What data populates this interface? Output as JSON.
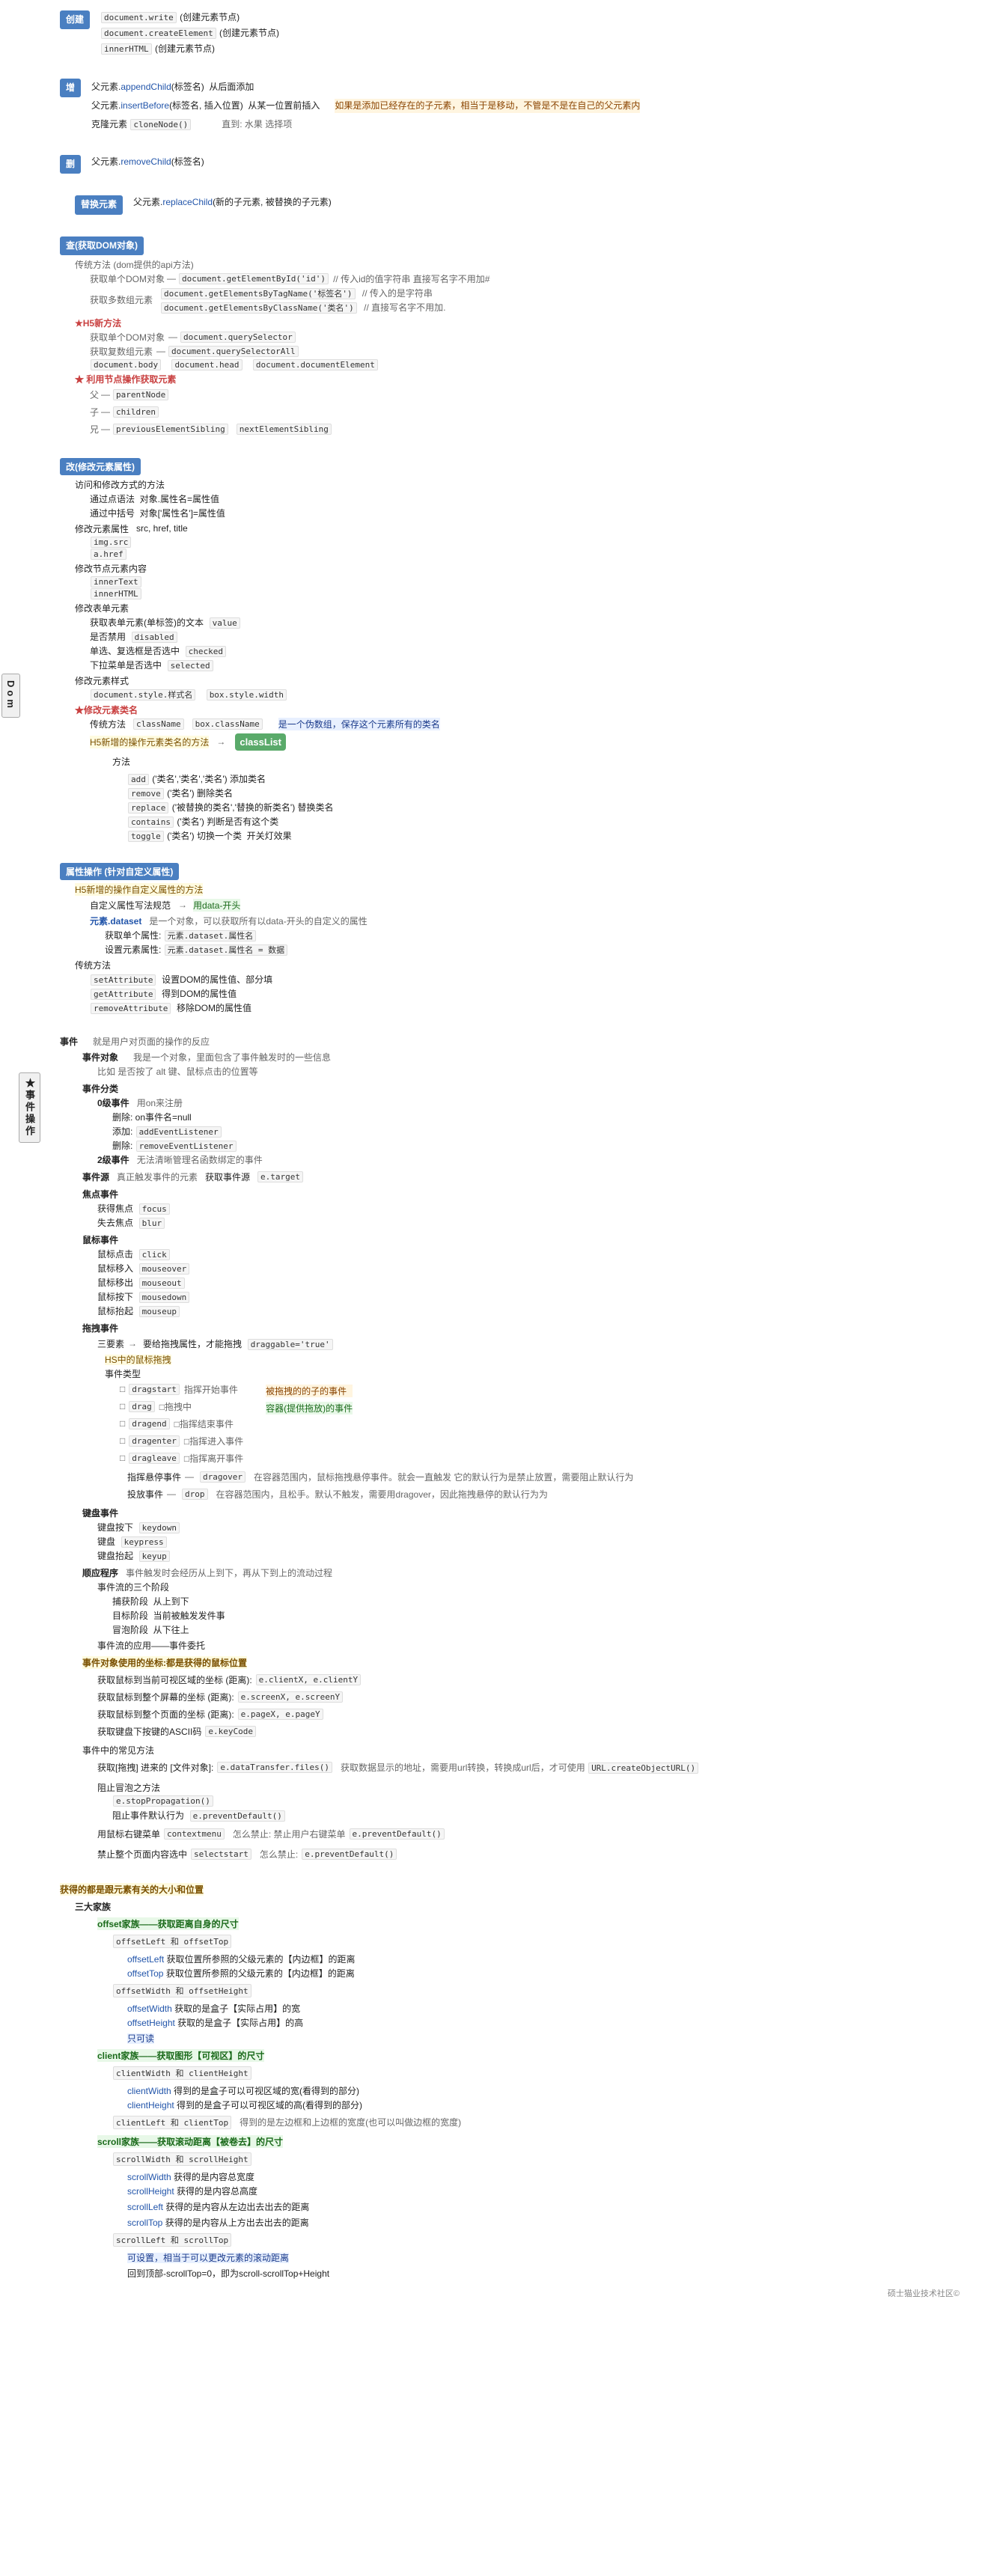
{
  "title": "Dom",
  "dom_label": "Dom",
  "sections": {
    "create_section": {
      "label": "创建",
      "color": "blue",
      "items": [
        "document.write (创建元素节点)",
        "document.createElement (创建元素节点)",
        "innerHTML (创建元素节点)"
      ]
    },
    "add_section": {
      "label": "增",
      "color": "blue",
      "items": [
        "父元素.appendChild(标签名) 从后面添加",
        "父元素.insertBefore(标签名, 插入位置) 从某一位置前插入",
        "克隆元素 cloneNode()"
      ],
      "note_orange": "如果是添加已经存在的子元素，相当于是移动，不管是不是在自己的父元素内",
      "note_right": "直到: 水果 选择项"
    },
    "del_section": {
      "label": "删",
      "color": "blue",
      "items": [
        "父元素.removeChild(标签名)"
      ]
    },
    "replace_section": {
      "label": "替换元素",
      "color": "blue",
      "items": [
        "父元素.replaceChild(新的子元素, 被替换的子元素)"
      ]
    },
    "query_section": {
      "label": "查(获取DOM对象)",
      "color": "blue",
      "h5_label": "★H5新方法",
      "traditional_label": "传统方法 (dom提供的api方法)",
      "get_single": "获取单个DOM对象",
      "get_multi": "获取多数组元素",
      "get_single_h5": "获取单个DOM对象",
      "get_multi_h5": "获取复数组元素",
      "methods": {
        "getElementById": "document.getElementById('id') // 传入id的值字符串 直接写名字不用加#",
        "getElementsByTagName": "document.getElementsByTagName('标签名') // 传入的是字符串",
        "getElementsByClassName": "document.getElementsByClassName('类名') // 直接写名字不用加.",
        "querySelector": "document.querySelector",
        "querySelectorAll": "document.querySelectorAll",
        "body": "document.body",
        "head": "document.head",
        "documentElement": "document.documentElement",
        "parentNode": "parentNode",
        "children": "children",
        "previousElementSibling": "previousElementSibling",
        "nextElementSibling": "nextElementSibling"
      },
      "note_red": "★ 利用节点操作获取元素",
      "sub_labels": {
        "parent": "父",
        "child": "子",
        "sibling": "兄"
      }
    },
    "modify_section": {
      "label": "改(修改元素属性)",
      "color": "blue",
      "items": {
        "visit_modify": "访问和修改方式的方法",
        "dot_notation": "通过点语法 对象.属性名=属性值",
        "bracket_notation": "通过中括号 对象['属性名']=属性值",
        "modify_src_href": "修改元素属性",
        "src_href_title": "src, href, title",
        "img_src": "img.src",
        "a_href": "a.href",
        "modify_content": "修改节点元素内容",
        "innerText": "innerText",
        "innerHTML": "innerHTML",
        "get_text_value": "获取表单元素(单标签)的文本  value",
        "modify_form_elem": "修改表单元素",
        "disabled": "是否禁用  disabled",
        "checked": "单选、复选框是否选中  checked",
        "selected": "下拉菜单是否选中  selected",
        "modify_style": "修改元素样式",
        "document_style": "document.style.样式名  box.style.width",
        "modify_class": "★修改元素类名",
        "traditional_method": "传统方法  className  box.className",
        "class_list_desc": "是一个伪数组，保存这个元素所有的类名",
        "classList_label": "classList",
        "classList_methods": {
          "add": "add ('类名','类名','类名') 添加类名",
          "remove": "remove ('类名') 删除类名",
          "replace": "replace ('被替换的类名','替换的新类名') 替换类名",
          "contains": "contains ('类名') 判断是否有这个类",
          "toggle": "toggle ('类名') 切换一个类  开关灯效果"
        },
        "h5_new_method_label": "H5新增的操作元素类名的方法"
      }
    },
    "attribute_section": {
      "label": "属性操作 (针对自定义属性)",
      "h5_label": "H5新增的操作自定义属性的方法",
      "h5_rule_label": "自定义属性写法规范",
      "h5_rule_value": "用data-开头",
      "h5_dataset_label": "元素.dataset",
      "h5_dataset_desc": "是一个对象，可以获取所有以data-开头的自定义的属性",
      "h5_dataset_methods": [
        "获取单个属性: 元素.dataset.属性名",
        "设置元素属性: 元素.dataset.属性名 = 数据"
      ],
      "traditional_methods": [
        "setAttribute 设置DOM的属性值、部分填",
        "getAttribute 得到DOM的属性值",
        "removeAttribute 移除DOM的属性值"
      ]
    },
    "events_section": {
      "label": "★事件操作",
      "event_object": {
        "label": "事件对象",
        "desc": "我是一个对象，里面包含了事件触发时的一些信息",
        "example": "比如 是否按了 alt 键、鼠标点击的位置等"
      },
      "event_classification": {
        "label": "事件分类",
        "level0": {
          "label": "0级事件",
          "registration": "用on来注册",
          "methods": [
            "删除: on事件名=null",
            "添加: addEventListener",
            "删除: removeEventListener"
          ]
        },
        "level2": {
          "label": "2级事件",
          "note": "无法清晰管理名函数绑定的事件"
        }
      },
      "event_source": {
        "label": "事件源",
        "desc": "真正触发事件的元素",
        "obtain_label": "获取事件源",
        "property": "e.target"
      },
      "focus_events": {
        "label": "焦点事件",
        "get_focus": "获得焦点  focus",
        "lose_focus": "失去焦点  blur"
      },
      "mouse_events": {
        "label": "鼠标事件",
        "click": "鼠标点击  click",
        "mouseover": "鼠标移入  mouseover",
        "mouseout": "鼠标移出  mouseout",
        "mousedown": "鼠标按下  mousedown",
        "mouseup": "鼠标抬起  mouseup"
      },
      "drag_events": {
        "label": "拖拽事件",
        "label_h5": "HS中的鼠标拖拽",
        "require": "要给拖拽属性，才能拖拽  draggable='true'",
        "three_elements": "三要素",
        "events_type_label": "事件类型",
        "drag_start": "dragstart  指挥开始事件",
        "drag": "drag  □拖拽中",
        "dragend": "dragend  □指挥结束事件",
        "dragenter": "dragenter  □指挥进入事件",
        "dragleave": "dragleave  □指挥离开事件",
        "dragover": "指挥悬停事件  dragover  在容器范围内，鼠标拖拽悬停事件。就会一直触发 它的默认行为是禁止放置，需要阻止默认行为",
        "drop": "投放事件  drop  在容器范围内，且松手。默认不触发，需要用dragover，因此拖拽悬停的默认行为为",
        "drag_item": "被拖拽的的子的事件",
        "drag_container": "容器(提供拖放)的事件"
      },
      "keyboard_events": {
        "label": "键盘事件",
        "keydown": "键盘按下  keydown",
        "keypress": "键盘  keypress",
        "keyup": "键盘抬起  keyup"
      },
      "event_flow": {
        "label": "顺应程序",
        "desc": "事件触发时会经历从上到下，再从下到上的流动过程",
        "phases": [
          "捕获阶段  从上到下",
          "目标阶段  当前被触发发件事",
          "冒泡阶段  从下往上"
        ]
      },
      "event_application": {
        "label": "事件流的应用——事件委托"
      },
      "event_target_label": "事件对象使用的坐标:都是获得的鼠标位置",
      "coordinate_methods": {
        "clientXY": "获取鼠标到当前可视区域的坐标 (距离): e.clientX, e.clientY",
        "screenXY": "获取鼠标到整个屏幕的坐标 (距离): e.screenX, e.screenY",
        "pageXY": "获取鼠标到整个页面的坐标 (距离): e.pageX, e.pageY"
      },
      "keycode": "获取键盘下按键的ASCII码  e.keyCode",
      "event_other_methods": {
        "files": "获取[拖拽] 进来的[文件对象]: e.dataTransfer.files()",
        "url": "获取数据显示的地址，需要用url转换，转换成url后，才可使用  URL.createObjectURL()",
        "stop_propagation": "阻止冒泡之方法  e.stopPropagation()",
        "prevent_default": "阻止事件默认行为  e.preventDefault()",
        "context_menu": "用鼠标右键菜单  contextmenu",
        "select_start": "怎么禁止: 禁止用户右键菜单  e.preventDefault()",
        "stop_page_select": "禁止整个页面内容选中  selectstart",
        "stop_page_prevent": "怎么禁止: e.preventDefault()"
      }
    },
    "position_size_section": {
      "label": "获得的都是跟元素有关的大小和位置",
      "three_families": {
        "label": "三大家族",
        "offset_family": {
          "label": "offset家族——获取距离自身的尺寸",
          "offsetLeft_Top": "offsetLeft 和 offsetTop",
          "offsetLeft_desc": "offsetLeft 获取位置所参照的父级元素的【内边框】的距离",
          "offsetTop_desc": "offsetTop 获取位置所参照的父级元素的【内边框】的距离",
          "offsetWidth_Height": "offsetWidth 和 offsetHeight",
          "offsetWidth_desc": "offsetWidth 获取的是盒子【实际占用】的宽",
          "offsetHeight_desc": "offsetHeight 获取的是盒子【实际占用】的高",
          "note": "只可读"
        },
        "client_family": {
          "label": "client家族——获取图形【可视区】的尺寸",
          "clientWidth_Height": "clientWidth 和 clientHeight",
          "clientWidth_desc": "clientWidth 得到的是盒子可以可视区域的宽(看得到的部分)",
          "clientHeight_desc": "clientHeight 得到的是盒子可以可视区域的高(看得到的部分)",
          "clientLeft_Top": "clientLeft 和 clientTop 得到的是左边框和上边框的宽度(也可以叫做边框的宽度)"
        },
        "scroll_family": {
          "label": "scroll家族——获取滚动距离【被卷去】的尺寸",
          "scrollWidth_Height": "scrollWidth 和 scrollHeight",
          "scrollWidth_desc": "scrollWidth 获得的是内容总宽度",
          "scrollHeight_desc": "scrollHeight 获得的是内容总高度",
          "scrollLeft_desc": "scrollLeft 获得的是内容从左边出去出去的距离",
          "scrollTop_desc": "scrollTop 获得的是内容从上方出去出去的距离",
          "scrollLeft_Top": "scrollLeft 和 scrollTop",
          "note": "可设置，相当于可以更改元素的滚动距离",
          "formula": "回到顶部-scrollTop=0，即为scroll-scrollTop+Height"
        }
      }
    }
  },
  "footer": "硕士猫业技术社区©"
}
